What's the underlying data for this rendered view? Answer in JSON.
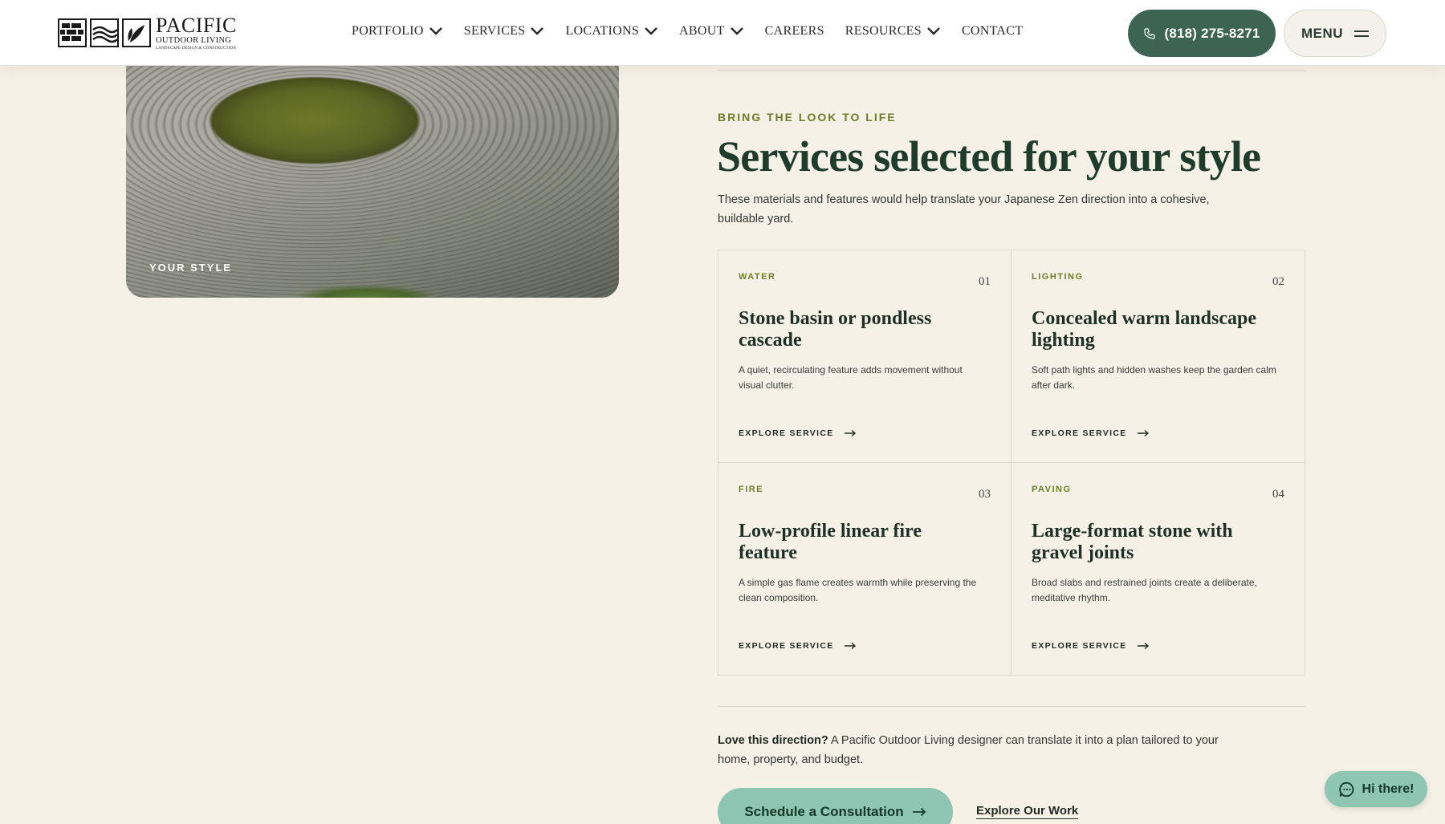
{
  "header": {
    "logo": {
      "title": "PACIFIC",
      "subtitle": "OUTDOOR LIVING",
      "tagline": "LANDSCAPE DESIGN & CONSTRUCTION"
    },
    "nav": [
      {
        "label": "PORTFOLIO",
        "dropdown": true
      },
      {
        "label": "SERVICES",
        "dropdown": true
      },
      {
        "label": "LOCATIONS",
        "dropdown": true
      },
      {
        "label": "ABOUT",
        "dropdown": true
      },
      {
        "label": "CAREERS",
        "dropdown": false
      },
      {
        "label": "RESOURCES",
        "dropdown": true
      },
      {
        "label": "CONTACT",
        "dropdown": false
      }
    ],
    "phone_label": "(818) 275-8271",
    "menu_label": "MENU"
  },
  "style_card": {
    "label": "YOUR STYLE"
  },
  "section": {
    "eyebrow": "BRING THE LOOK TO LIFE",
    "title": "Services selected for your style",
    "description": "These materials and features would help translate your Japanese Zen direction into a cohesive, buildable yard."
  },
  "services": [
    {
      "category": "WATER",
      "number": "01",
      "title": "Stone basin or pondless cascade",
      "description": "A quiet, recirculating feature adds movement without visual clutter.",
      "link": "EXPLORE SERVICE"
    },
    {
      "category": "LIGHTING",
      "number": "02",
      "title": "Concealed warm landscape lighting",
      "description": "Soft path lights and hidden washes keep the garden calm after dark.",
      "link": "EXPLORE SERVICE"
    },
    {
      "category": "FIRE",
      "number": "03",
      "title": "Low-profile linear fire feature",
      "description": "A simple gas flame creates warmth while preserving the clean composition.",
      "link": "EXPLORE SERVICE"
    },
    {
      "category": "PAVING",
      "number": "04",
      "title": "Large-format stone with gravel joints",
      "description": "Broad slabs and restrained joints create a deliberate, meditative rhythm.",
      "link": "EXPLORE SERVICE"
    }
  ],
  "cta": {
    "lead": "Love this direction?",
    "text": " A Pacific Outdoor Living designer can translate it into a plan tailored to your home, property, and budget.",
    "primary_button": "Schedule a Consultation",
    "secondary_link": "Explore Our Work"
  },
  "chat": {
    "label": "Hi there!"
  },
  "colors": {
    "brand_green": "#3d6453",
    "accent_olive": "#6b7e2a",
    "mint": "#8ec5b3",
    "background": "#f5f1e7"
  }
}
